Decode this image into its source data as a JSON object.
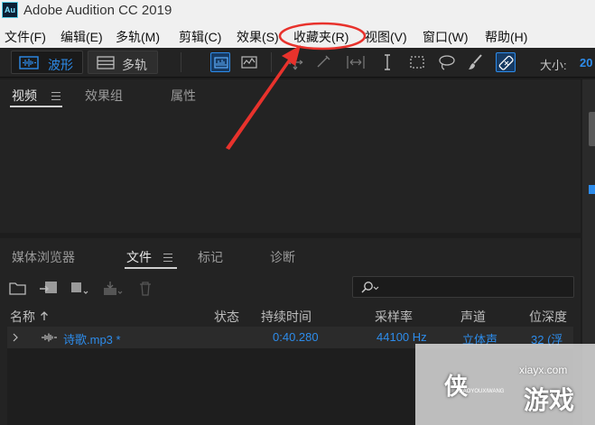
{
  "app": {
    "icon_text": "Au",
    "title": "Adobe Audition CC 2019"
  },
  "menu": {
    "items": [
      "文件(F)",
      "编辑(E)",
      "多轨(M)",
      "剪辑(C)",
      "效果(S)",
      "收藏夹(R)",
      "视图(V)",
      "窗口(W)",
      "帮助(H)"
    ],
    "highlighted": "收藏夹(R)"
  },
  "toolbar": {
    "waveform_label": "波形",
    "multitrack_label": "多轨",
    "size_label": "大小:",
    "size_value": "20"
  },
  "top_panel": {
    "tabs": [
      "视频",
      "效果组",
      "属性"
    ],
    "active_tab": "视频"
  },
  "bottom_panel": {
    "tabs": [
      "媒体浏览器",
      "文件",
      "标记",
      "诊断"
    ],
    "active_tab": "文件",
    "search": {
      "placeholder": ""
    },
    "columns": [
      "名称",
      "状态",
      "持续时间",
      "采样率",
      "声道",
      "位深度"
    ],
    "files": [
      {
        "name": "诗歌.mp3 *",
        "status": "",
        "duration": "0:40.280",
        "sample_rate": "44100 Hz",
        "channels": "立体声",
        "bit_depth": "32 (浮"
      }
    ]
  },
  "watermark": {
    "site": "xiayx.com",
    "text_left": "侠",
    "text_right": "游戏",
    "small": "JIAOYOUXIWANG"
  },
  "colors": {
    "accent": "#2d8ceb",
    "annotation": "#e8322c",
    "panel_bg": "#232323",
    "menu_bg": "#f0f0f0"
  }
}
